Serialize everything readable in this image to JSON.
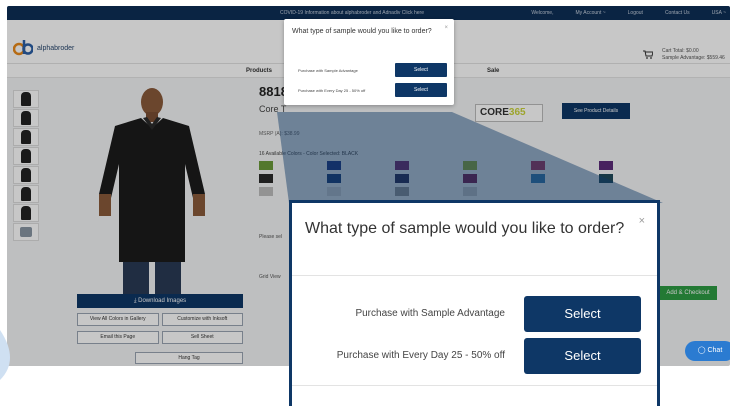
{
  "topbar": {
    "notice": "COVID-19 Information about alphabroder and Adnadiv Click here",
    "links": [
      "Welcome,",
      "My Account ~",
      "Logout",
      "Contact Us",
      "USA ~"
    ]
  },
  "header": {
    "logo": "alphabroder",
    "cart_line1": "Cart Total: $0.00",
    "cart_line2": "Sample Advantage: $559.46"
  },
  "nav": {
    "items": [
      "Products",
      "Sale"
    ]
  },
  "product": {
    "style": "8818",
    "name": "Core T",
    "msrp": "MSRP (A): $38.99",
    "colors_label": "16 Available Colors - Color Selected: BLACK",
    "brand_core": "CORE",
    "brand_suffix": "365",
    "see_details": "See Product Details"
  },
  "left_buttons": {
    "download": "Download Images",
    "view_all": "View All Colors in Gallery",
    "customize": "Customize with Inksoft",
    "email": "Email this Page",
    "sell_sheet": "Sell Sheet",
    "hang_tag": "Hang Tag"
  },
  "right_panel": {
    "please": "Please sel",
    "grid": "Grid View",
    "add_checkout": "Add & Checkout"
  },
  "modal": {
    "question": "What type of sample would you like to order?",
    "close": "×",
    "options": [
      {
        "label": "Purchase with Sample Advantage",
        "button": "Select"
      },
      {
        "label": "Purchase with Every Day 25 - 50% off",
        "button": "Select"
      }
    ]
  },
  "chat": {
    "label": "Chat"
  },
  "colors": {
    "navy": "#0e3766",
    "topbar": "#0e2f57",
    "green": "#2e9b43",
    "chat": "#2b7bd1"
  },
  "swatch_colors": [
    "#6b9a3a",
    "#1f3a8a",
    "#7a2c6f",
    "#9ab53a",
    "#b23a62",
    "#5d2c7a",
    "#2a2a2a",
    "#1a3e7a",
    "#2b2b56",
    "#7a2050",
    "#3a7fb5",
    "#1f4a5a",
    "#bdbdbd",
    "#d9d9d9",
    "#9e9e9e",
    "#cfcfcf"
  ]
}
